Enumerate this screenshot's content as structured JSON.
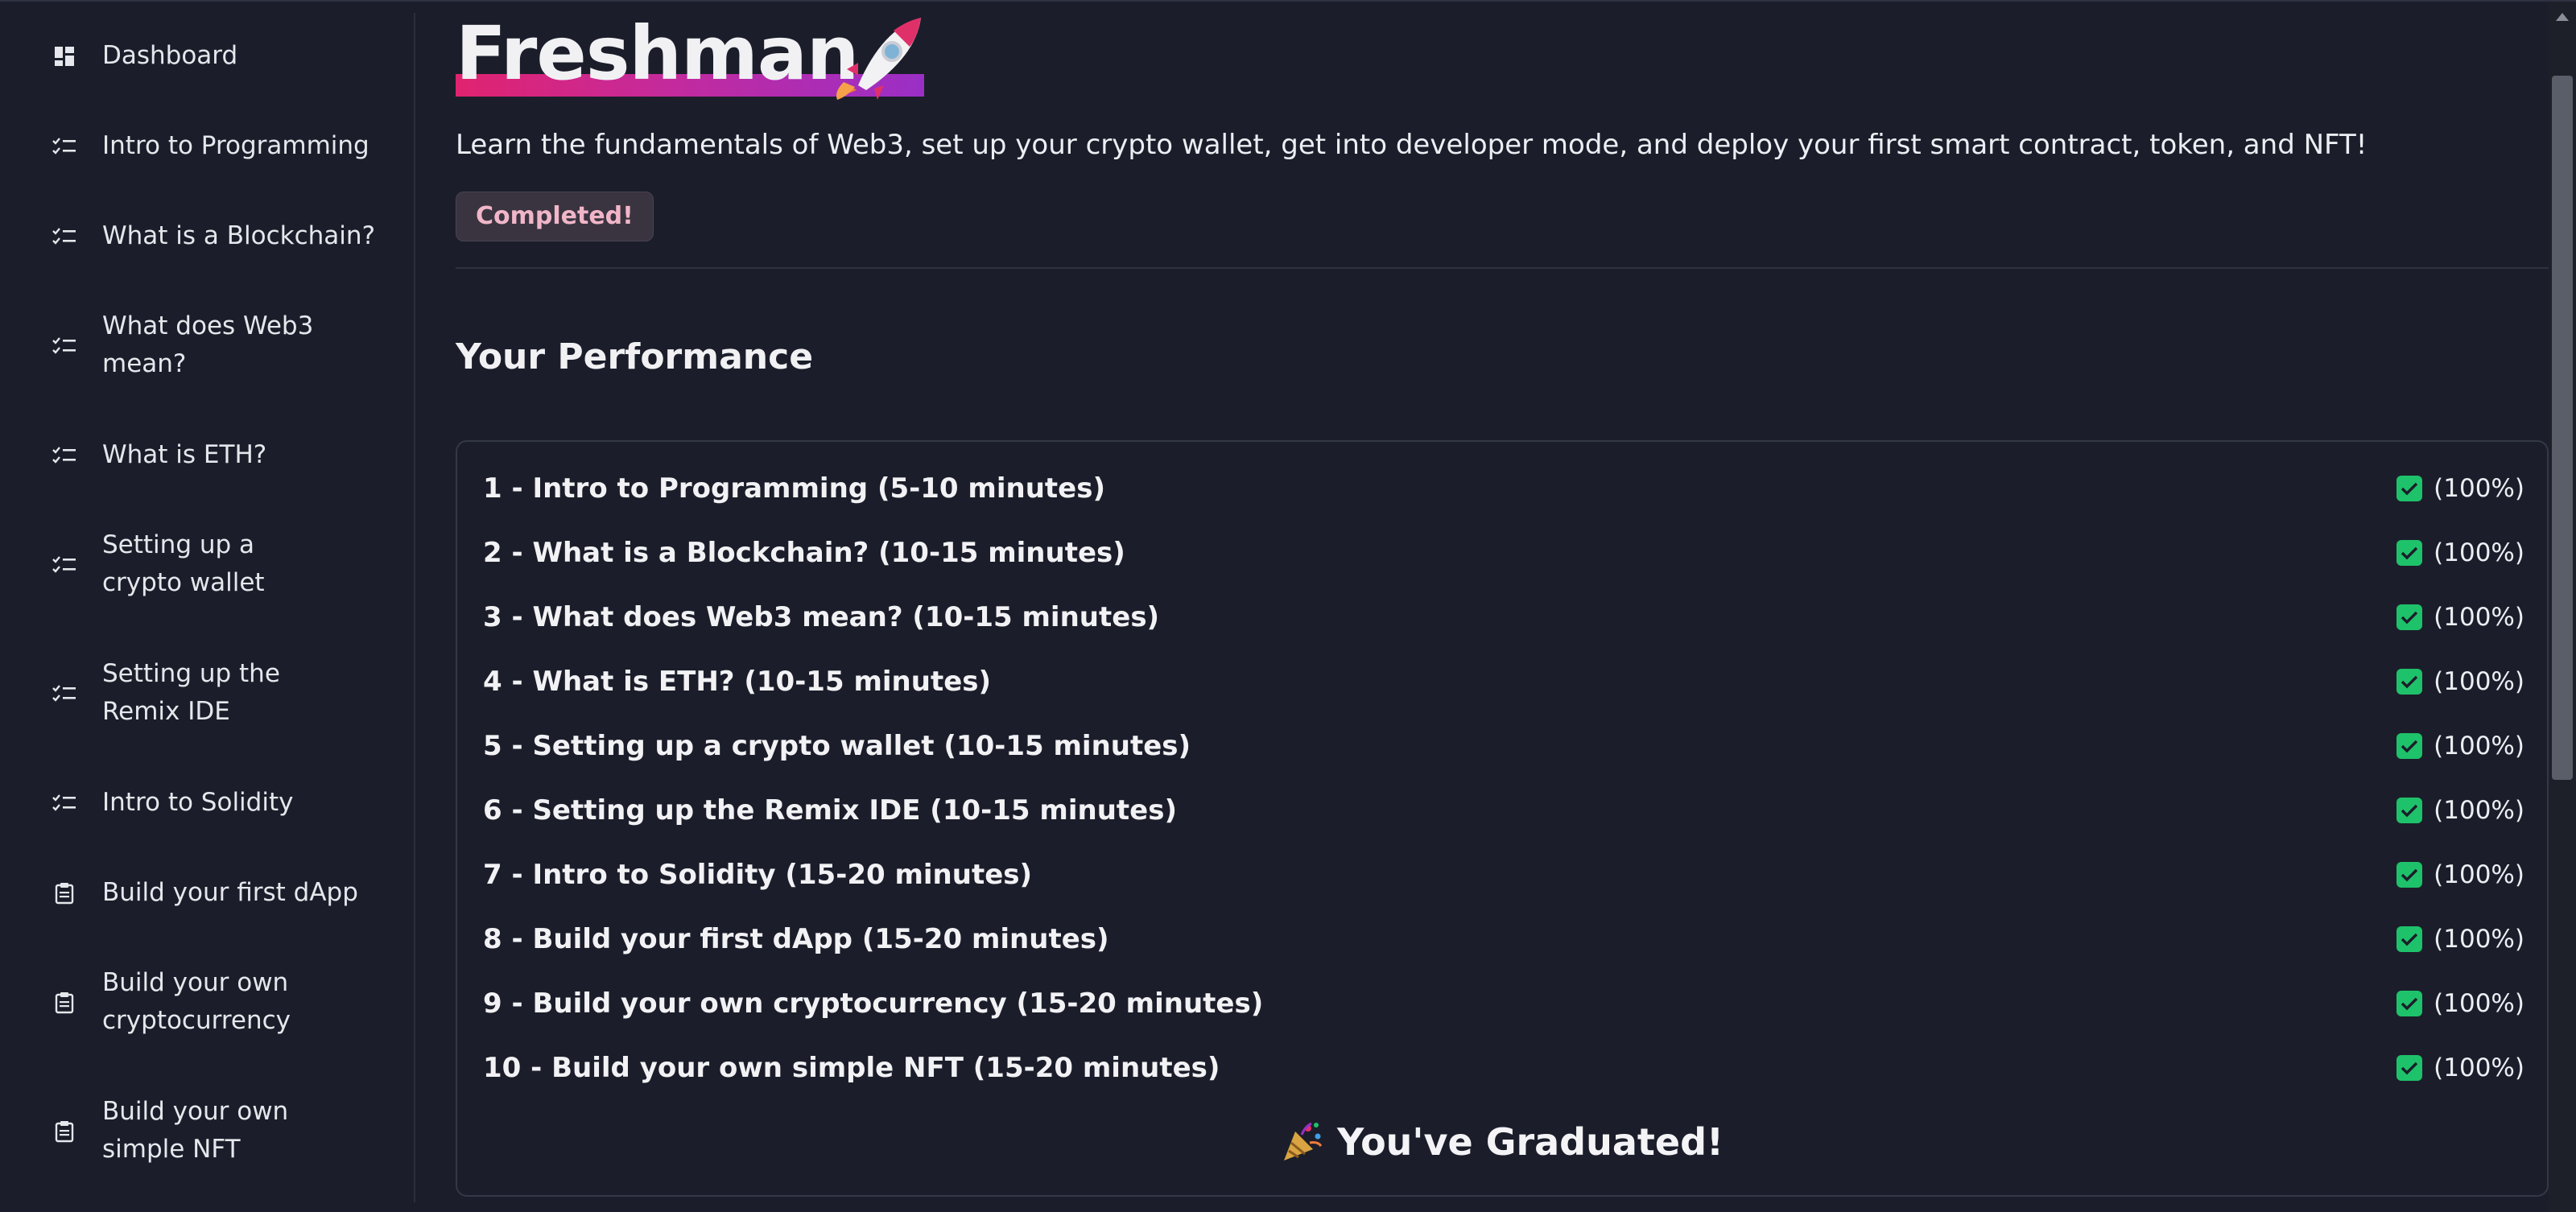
{
  "sidebar": {
    "items": [
      {
        "label": "Dashboard",
        "icon": "dashboard-icon"
      },
      {
        "label": "Intro to Programming",
        "icon": "checklist-icon"
      },
      {
        "label": "What is a Blockchain?",
        "icon": "checklist-icon"
      },
      {
        "label": "What does Web3 mean?",
        "icon": "checklist-icon"
      },
      {
        "label": "What is ETH?",
        "icon": "checklist-icon"
      },
      {
        "label": "Setting up a crypto wallet",
        "icon": "checklist-icon"
      },
      {
        "label": "Setting up the Remix IDE",
        "icon": "checklist-icon"
      },
      {
        "label": "Intro to Solidity",
        "icon": "checklist-icon"
      },
      {
        "label": "Build your first dApp",
        "icon": "clipboard-icon"
      },
      {
        "label": "Build your own cryptocurrency",
        "icon": "clipboard-icon"
      },
      {
        "label": "Build your own simple NFT",
        "icon": "clipboard-icon"
      }
    ]
  },
  "header": {
    "title": "Freshman",
    "title_icon": "rocket-icon",
    "subtitle": "Learn the fundamentals of Web3, set up your crypto wallet, get into developer mode, and deploy your first smart contract, token, and NFT!",
    "badge": "Completed!"
  },
  "performance": {
    "title": "Your Performance",
    "rows": [
      {
        "name": "1 - Intro to Programming (5-10 minutes)",
        "pct": "(100%)"
      },
      {
        "name": "2 - What is a Blockchain? (10-15 minutes)",
        "pct": "(100%)"
      },
      {
        "name": "3 - What does Web3 mean? (10-15 minutes)",
        "pct": "(100%)"
      },
      {
        "name": "4 - What is ETH? (10-15 minutes)",
        "pct": "(100%)"
      },
      {
        "name": "5 - Setting up a crypto wallet (10-15 minutes)",
        "pct": "(100%)"
      },
      {
        "name": "6 - Setting up the Remix IDE (10-15 minutes)",
        "pct": "(100%)"
      },
      {
        "name": "7 - Intro to Solidity (15-20 minutes)",
        "pct": "(100%)"
      },
      {
        "name": "8 - Build your first dApp (15-20 minutes)",
        "pct": "(100%)"
      },
      {
        "name": "9 - Build your own cryptocurrency (15-20 minutes)",
        "pct": "(100%)"
      },
      {
        "name": "10 - Build your own simple NFT (15-20 minutes)",
        "pct": "(100%)"
      }
    ],
    "graduation": "You've Graduated!",
    "graduation_icon": "party-popper-icon"
  },
  "colors": {
    "background": "#1b1e2a",
    "accent_gradient_start": "#e0236f",
    "accent_gradient_end": "#9a2fc6",
    "check_green": "#1ec26a",
    "badge_text": "#f0b6c8"
  }
}
